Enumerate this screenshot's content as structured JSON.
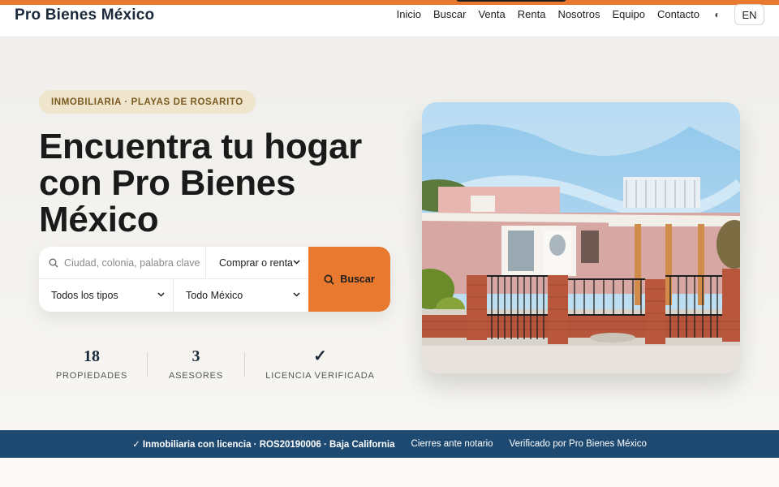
{
  "header": {
    "brand": "Pro Bienes México",
    "nav": [
      "Inicio",
      "Buscar",
      "Venta",
      "Renta",
      "Nosotros",
      "Equipo",
      "Contacto"
    ],
    "theme_icon": "◐",
    "lang": "EN"
  },
  "hero": {
    "badge": "INMOBILIARIA · PLAYAS DE ROSARITO",
    "title": "Encuentra tu hogar con Pro Bienes México",
    "search": {
      "placeholder": "Ciudad, colonia, palabra clave",
      "operation": "Comprar o renta",
      "type": "Todos los tipos",
      "region": "Todo México",
      "button": "Buscar"
    },
    "stats": [
      {
        "value": "18",
        "label": "PROPIEDADES"
      },
      {
        "value": "3",
        "label": "ASESORES"
      },
      {
        "value": "✓",
        "label": "LICENCIA VERIFICADA"
      }
    ]
  },
  "trust": {
    "license": "✓ Inmobiliaria con licencia · ROS20190006 · Baja California",
    "notary": "Cierres ante notario",
    "verified": "Verificado por Pro Bienes México"
  },
  "colors": {
    "accent": "#e8792e",
    "navy": "#1e4a72",
    "badge_bg": "#efe4cc",
    "badge_text": "#7a5a1f"
  },
  "icons": {
    "search": "search-icon",
    "theme": "theme-toggle-icon",
    "chevron": "chevron-down-icon"
  }
}
